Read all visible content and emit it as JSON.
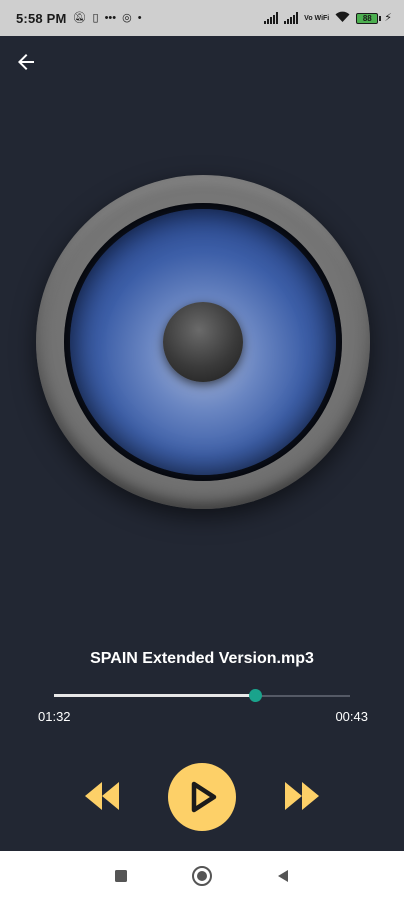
{
  "status_bar": {
    "time": "5:58 PM",
    "network_label": "Vo WiFi",
    "battery_level": "88"
  },
  "player": {
    "track_title": "SPAIN Extended Version.mp3",
    "elapsed_time": "01:32",
    "remaining_time": "00:43",
    "progress_fraction": 0.68
  },
  "icons": {
    "back": "arrow-left-icon",
    "rewind": "rewind-icon",
    "play": "play-icon",
    "fast_forward": "fast-forward-icon",
    "nav_recents": "square-icon",
    "nav_home": "circle-icon",
    "nav_back": "triangle-icon"
  },
  "colors": {
    "background": "#222733",
    "accent": "#fdd068",
    "seek_thumb": "#1aa38c",
    "speaker_blue": "#3d5fa8"
  }
}
